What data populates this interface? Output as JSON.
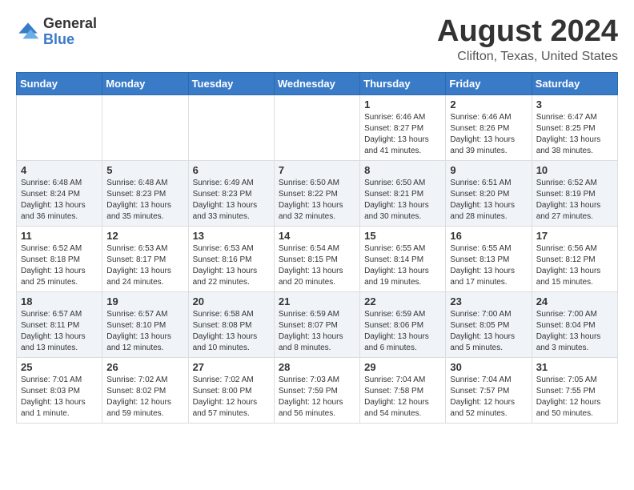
{
  "header": {
    "logo_general": "General",
    "logo_blue": "Blue",
    "month_year": "August 2024",
    "location": "Clifton, Texas, United States"
  },
  "weekdays": [
    "Sunday",
    "Monday",
    "Tuesday",
    "Wednesday",
    "Thursday",
    "Friday",
    "Saturday"
  ],
  "weeks": [
    [
      {
        "day": "",
        "sunrise": "",
        "sunset": "",
        "daylight": ""
      },
      {
        "day": "",
        "sunrise": "",
        "sunset": "",
        "daylight": ""
      },
      {
        "day": "",
        "sunrise": "",
        "sunset": "",
        "daylight": ""
      },
      {
        "day": "",
        "sunrise": "",
        "sunset": "",
        "daylight": ""
      },
      {
        "day": "1",
        "sunrise": "Sunrise: 6:46 AM",
        "sunset": "Sunset: 8:27 PM",
        "daylight": "Daylight: 13 hours and 41 minutes."
      },
      {
        "day": "2",
        "sunrise": "Sunrise: 6:46 AM",
        "sunset": "Sunset: 8:26 PM",
        "daylight": "Daylight: 13 hours and 39 minutes."
      },
      {
        "day": "3",
        "sunrise": "Sunrise: 6:47 AM",
        "sunset": "Sunset: 8:25 PM",
        "daylight": "Daylight: 13 hours and 38 minutes."
      }
    ],
    [
      {
        "day": "4",
        "sunrise": "Sunrise: 6:48 AM",
        "sunset": "Sunset: 8:24 PM",
        "daylight": "Daylight: 13 hours and 36 minutes."
      },
      {
        "day": "5",
        "sunrise": "Sunrise: 6:48 AM",
        "sunset": "Sunset: 8:23 PM",
        "daylight": "Daylight: 13 hours and 35 minutes."
      },
      {
        "day": "6",
        "sunrise": "Sunrise: 6:49 AM",
        "sunset": "Sunset: 8:23 PM",
        "daylight": "Daylight: 13 hours and 33 minutes."
      },
      {
        "day": "7",
        "sunrise": "Sunrise: 6:50 AM",
        "sunset": "Sunset: 8:22 PM",
        "daylight": "Daylight: 13 hours and 32 minutes."
      },
      {
        "day": "8",
        "sunrise": "Sunrise: 6:50 AM",
        "sunset": "Sunset: 8:21 PM",
        "daylight": "Daylight: 13 hours and 30 minutes."
      },
      {
        "day": "9",
        "sunrise": "Sunrise: 6:51 AM",
        "sunset": "Sunset: 8:20 PM",
        "daylight": "Daylight: 13 hours and 28 minutes."
      },
      {
        "day": "10",
        "sunrise": "Sunrise: 6:52 AM",
        "sunset": "Sunset: 8:19 PM",
        "daylight": "Daylight: 13 hours and 27 minutes."
      }
    ],
    [
      {
        "day": "11",
        "sunrise": "Sunrise: 6:52 AM",
        "sunset": "Sunset: 8:18 PM",
        "daylight": "Daylight: 13 hours and 25 minutes."
      },
      {
        "day": "12",
        "sunrise": "Sunrise: 6:53 AM",
        "sunset": "Sunset: 8:17 PM",
        "daylight": "Daylight: 13 hours and 24 minutes."
      },
      {
        "day": "13",
        "sunrise": "Sunrise: 6:53 AM",
        "sunset": "Sunset: 8:16 PM",
        "daylight": "Daylight: 13 hours and 22 minutes."
      },
      {
        "day": "14",
        "sunrise": "Sunrise: 6:54 AM",
        "sunset": "Sunset: 8:15 PM",
        "daylight": "Daylight: 13 hours and 20 minutes."
      },
      {
        "day": "15",
        "sunrise": "Sunrise: 6:55 AM",
        "sunset": "Sunset: 8:14 PM",
        "daylight": "Daylight: 13 hours and 19 minutes."
      },
      {
        "day": "16",
        "sunrise": "Sunrise: 6:55 AM",
        "sunset": "Sunset: 8:13 PM",
        "daylight": "Daylight: 13 hours and 17 minutes."
      },
      {
        "day": "17",
        "sunrise": "Sunrise: 6:56 AM",
        "sunset": "Sunset: 8:12 PM",
        "daylight": "Daylight: 13 hours and 15 minutes."
      }
    ],
    [
      {
        "day": "18",
        "sunrise": "Sunrise: 6:57 AM",
        "sunset": "Sunset: 8:11 PM",
        "daylight": "Daylight: 13 hours and 13 minutes."
      },
      {
        "day": "19",
        "sunrise": "Sunrise: 6:57 AM",
        "sunset": "Sunset: 8:10 PM",
        "daylight": "Daylight: 13 hours and 12 minutes."
      },
      {
        "day": "20",
        "sunrise": "Sunrise: 6:58 AM",
        "sunset": "Sunset: 8:08 PM",
        "daylight": "Daylight: 13 hours and 10 minutes."
      },
      {
        "day": "21",
        "sunrise": "Sunrise: 6:59 AM",
        "sunset": "Sunset: 8:07 PM",
        "daylight": "Daylight: 13 hours and 8 minutes."
      },
      {
        "day": "22",
        "sunrise": "Sunrise: 6:59 AM",
        "sunset": "Sunset: 8:06 PM",
        "daylight": "Daylight: 13 hours and 6 minutes."
      },
      {
        "day": "23",
        "sunrise": "Sunrise: 7:00 AM",
        "sunset": "Sunset: 8:05 PM",
        "daylight": "Daylight: 13 hours and 5 minutes."
      },
      {
        "day": "24",
        "sunrise": "Sunrise: 7:00 AM",
        "sunset": "Sunset: 8:04 PM",
        "daylight": "Daylight: 13 hours and 3 minutes."
      }
    ],
    [
      {
        "day": "25",
        "sunrise": "Sunrise: 7:01 AM",
        "sunset": "Sunset: 8:03 PM",
        "daylight": "Daylight: 13 hours and 1 minute."
      },
      {
        "day": "26",
        "sunrise": "Sunrise: 7:02 AM",
        "sunset": "Sunset: 8:02 PM",
        "daylight": "Daylight: 12 hours and 59 minutes."
      },
      {
        "day": "27",
        "sunrise": "Sunrise: 7:02 AM",
        "sunset": "Sunset: 8:00 PM",
        "daylight": "Daylight: 12 hours and 57 minutes."
      },
      {
        "day": "28",
        "sunrise": "Sunrise: 7:03 AM",
        "sunset": "Sunset: 7:59 PM",
        "daylight": "Daylight: 12 hours and 56 minutes."
      },
      {
        "day": "29",
        "sunrise": "Sunrise: 7:04 AM",
        "sunset": "Sunset: 7:58 PM",
        "daylight": "Daylight: 12 hours and 54 minutes."
      },
      {
        "day": "30",
        "sunrise": "Sunrise: 7:04 AM",
        "sunset": "Sunset: 7:57 PM",
        "daylight": "Daylight: 12 hours and 52 minutes."
      },
      {
        "day": "31",
        "sunrise": "Sunrise: 7:05 AM",
        "sunset": "Sunset: 7:55 PM",
        "daylight": "Daylight: 12 hours and 50 minutes."
      }
    ]
  ]
}
